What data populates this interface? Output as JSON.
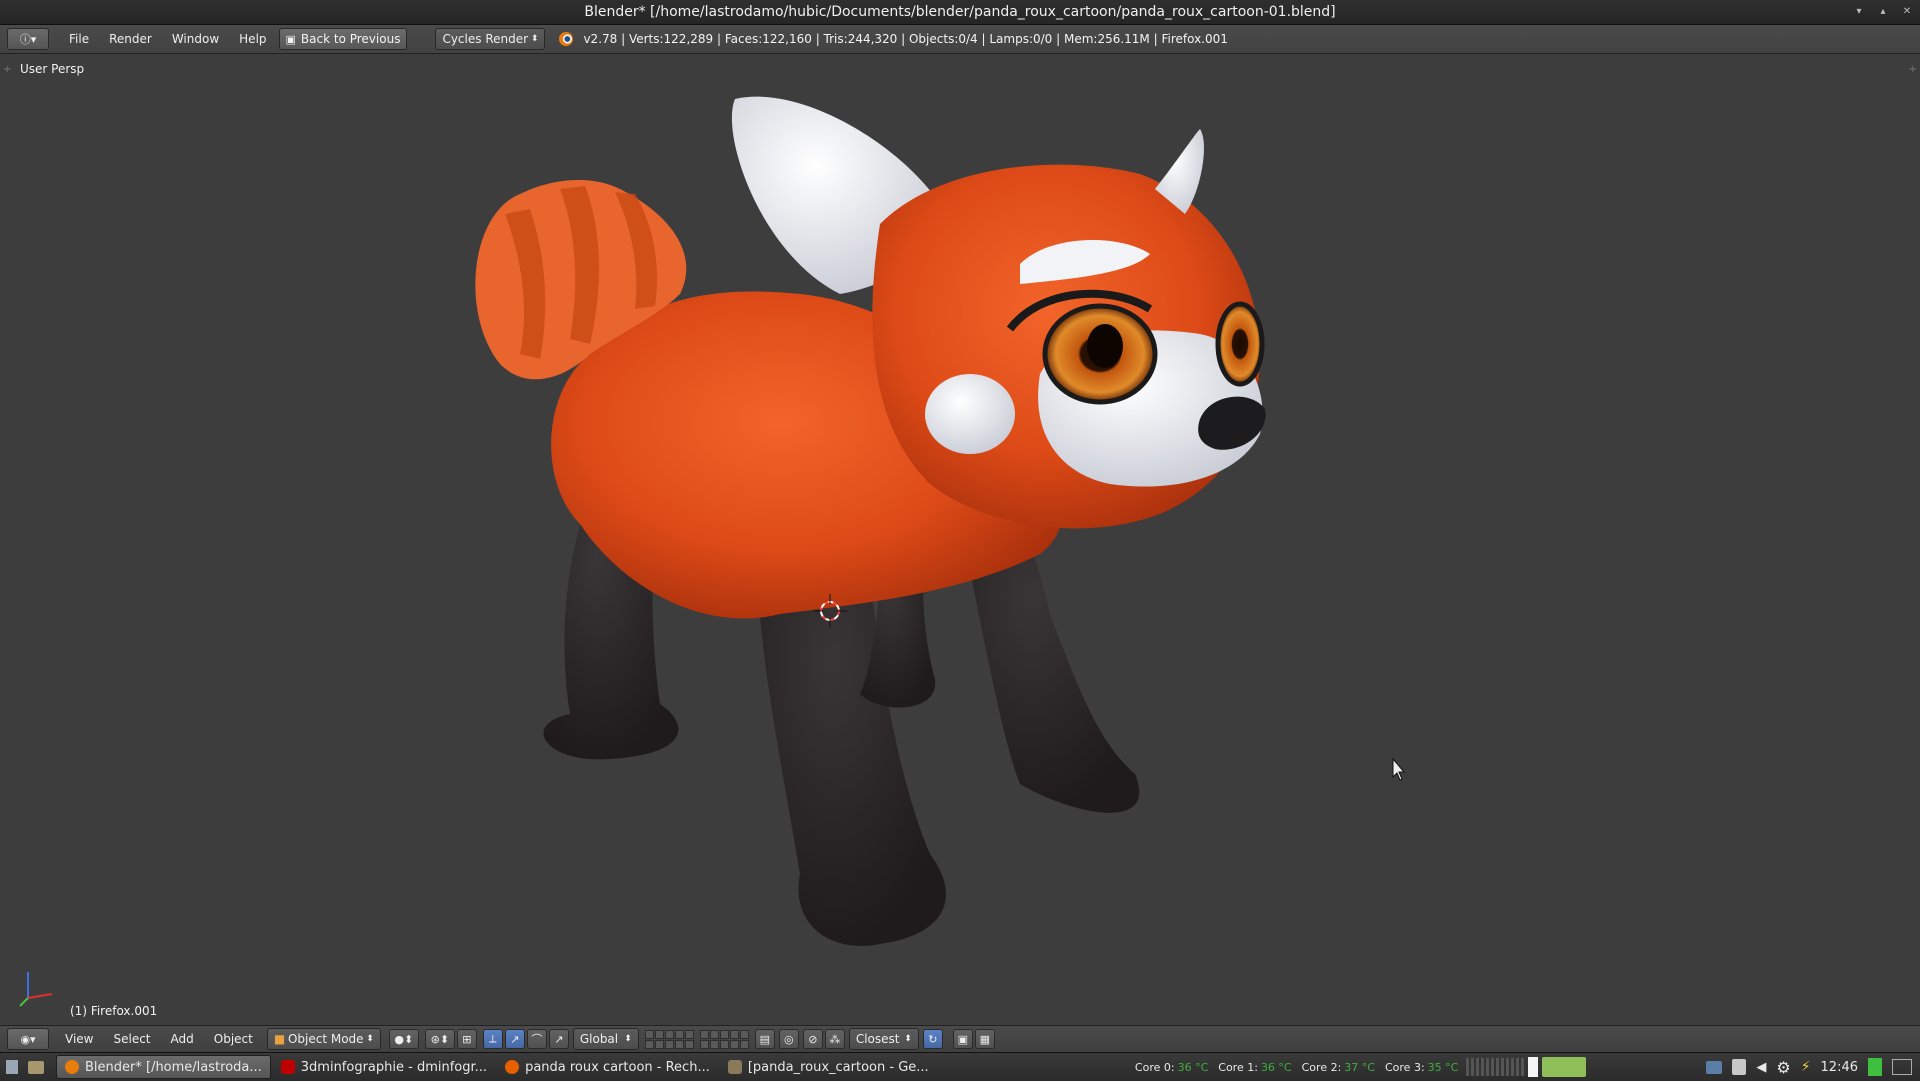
{
  "window": {
    "title": "Blender* [/home/lastrodamo/hubic/Documents/blender/panda_roux_cartoon/panda_roux_cartoon-01.blend]"
  },
  "info_header": {
    "menus": [
      "File",
      "Render",
      "Window",
      "Help"
    ],
    "back_label": "Back to Previous",
    "engine": "Cycles Render",
    "stats": "v2.78 | Verts:122,289 | Faces:122,160 | Tris:244,320 | Objects:0/4 | Lamps:0/0 | Mem:256.11M | Firefox.001"
  },
  "viewport": {
    "view_label": "User Persp",
    "object_label": "(1) Firefox.001"
  },
  "view3d_header": {
    "menus": [
      "View",
      "Select",
      "Add",
      "Object"
    ],
    "mode": "Object Mode",
    "orientation": "Global",
    "snap_target": "Closest"
  },
  "taskbar": {
    "tasks": [
      {
        "label": "Blender* [/home/lastroda...",
        "icon": "blender-icon",
        "color": "#e87d0d"
      },
      {
        "label": "3dminfographie - dminfogr...",
        "icon": "filezilla-icon",
        "color": "#bf0000"
      },
      {
        "label": "panda roux cartoon - Rech...",
        "icon": "firefox-icon",
        "color": "#e66000"
      },
      {
        "label": "[panda_roux_cartoon - Ge...",
        "icon": "folder-icon",
        "color": "#8a7a5a"
      }
    ],
    "cores": [
      {
        "label": "Core 0:",
        "temp": "36 °C"
      },
      {
        "label": "Core 1:",
        "temp": "36 °C"
      },
      {
        "label": "Core 2:",
        "temp": "37 °C"
      },
      {
        "label": "Core 3:",
        "temp": "35 °C"
      }
    ],
    "clock": "12:46"
  },
  "colors": {
    "viewport_bg": "#3d3d3d",
    "fur_orange": "#e0501a",
    "fur_white": "#e8eaf0",
    "fur_dark": "#2a2627",
    "active_blue": "#5b82c4"
  }
}
